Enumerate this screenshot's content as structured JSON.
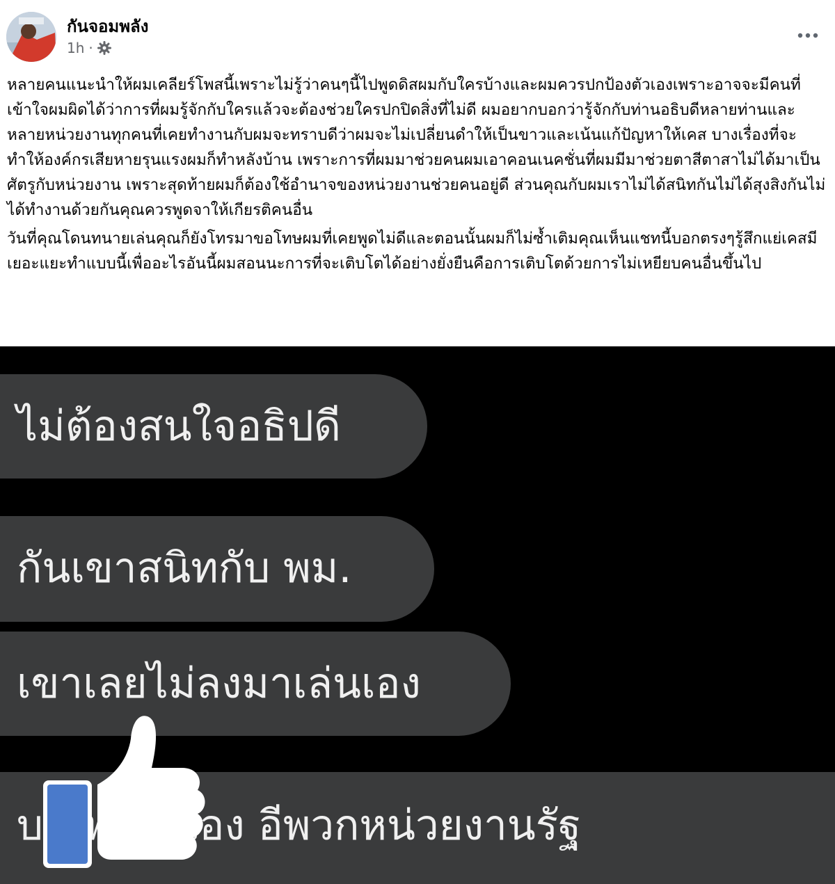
{
  "post": {
    "author": "กันจอมพลัง",
    "time": "1h",
    "separator": "·",
    "audience_icon": "gear-icon",
    "more_icon": "more-horizontal-icon",
    "paragraphs": [
      "หลายคนแนะนำให้ผมเคลียร์โพสนี้เพราะไม่รู้ว่าคนๆนี้ไปพูดดิสผมกับใครบ้างและผมควรปกป้องตัวเองเพราะอาจจะมีคนที่เข้าใจผมผิดได้ว่าการที่ผมรู้จักกับใครแล้วจะต้องช่วยใครปกปิดสิ่งที่ไม่ดี ผมอยากบอกว่ารู้จักกับท่านอธิบดีหลายท่านและหลายหน่วยงานทุกคนที่เคยทำงานกับผมจะทราบดีว่าผมจะไม่เปลี่ยนดำให้เป็นขาวและเน้นแก้ปัญหาให้เคส บางเรื่องที่จะทำให้องค์กรเสียหายรุนแรงผมก็ทำหลังบ้าน เพราะการที่ผมมาช่วยคนผมเอาคอนเนคชั่นที่ผมมีมาช่วยตาสีตาสาไม่ได้มาเป็นศัตรูกับหน่วยงาน เพราะสุดท้ายผมก็ต้องใช้อำนาจของหน่วยงานช่วยคนอยู่ดี ส่วนคุณกับผมเราไม่ได้สนิทกันไม่ได้สุงสิงกันไม่ได้ทำงานด้วยกันคุณควรพูดจาให้เกียรติคนอื่น",
      " วันที่คุณโดนทนายเล่นคุณก็ยังโทรมาขอโทษผมที่เคยพูดไม่ดีและตอนนั้นผมก็ไม่ซ้ำเติมคุณเห็นแชทนี้บอกตรงๆรู้สึกแย่เคสมีเยอะแยะทำแบบนี้เพื่ออะไรอันนี้ผมสอนนะการที่จะเติบโตได้อย่างยั่งยืนคือการเติบโตด้วยการไม่เหยียบคนอื่นขึ้นไป"
    ]
  },
  "chat": {
    "bubbles": [
      "ไม่ต้องสนใจอธิปดี",
      "กันเขาสนิทกับ พม.",
      "เขาเลยไม่ลงมาเล่นเอง",
      "บ        พี่พาลุยเอง อีพวกหน่วยงานรัฐ"
    ],
    "overlay_icon": "thumbs-up-icon",
    "colors": {
      "background": "#000000",
      "bubble": "#3a3b3c",
      "bubble_text": "#f0f0f0",
      "like_blue": "#4a7acb"
    }
  }
}
